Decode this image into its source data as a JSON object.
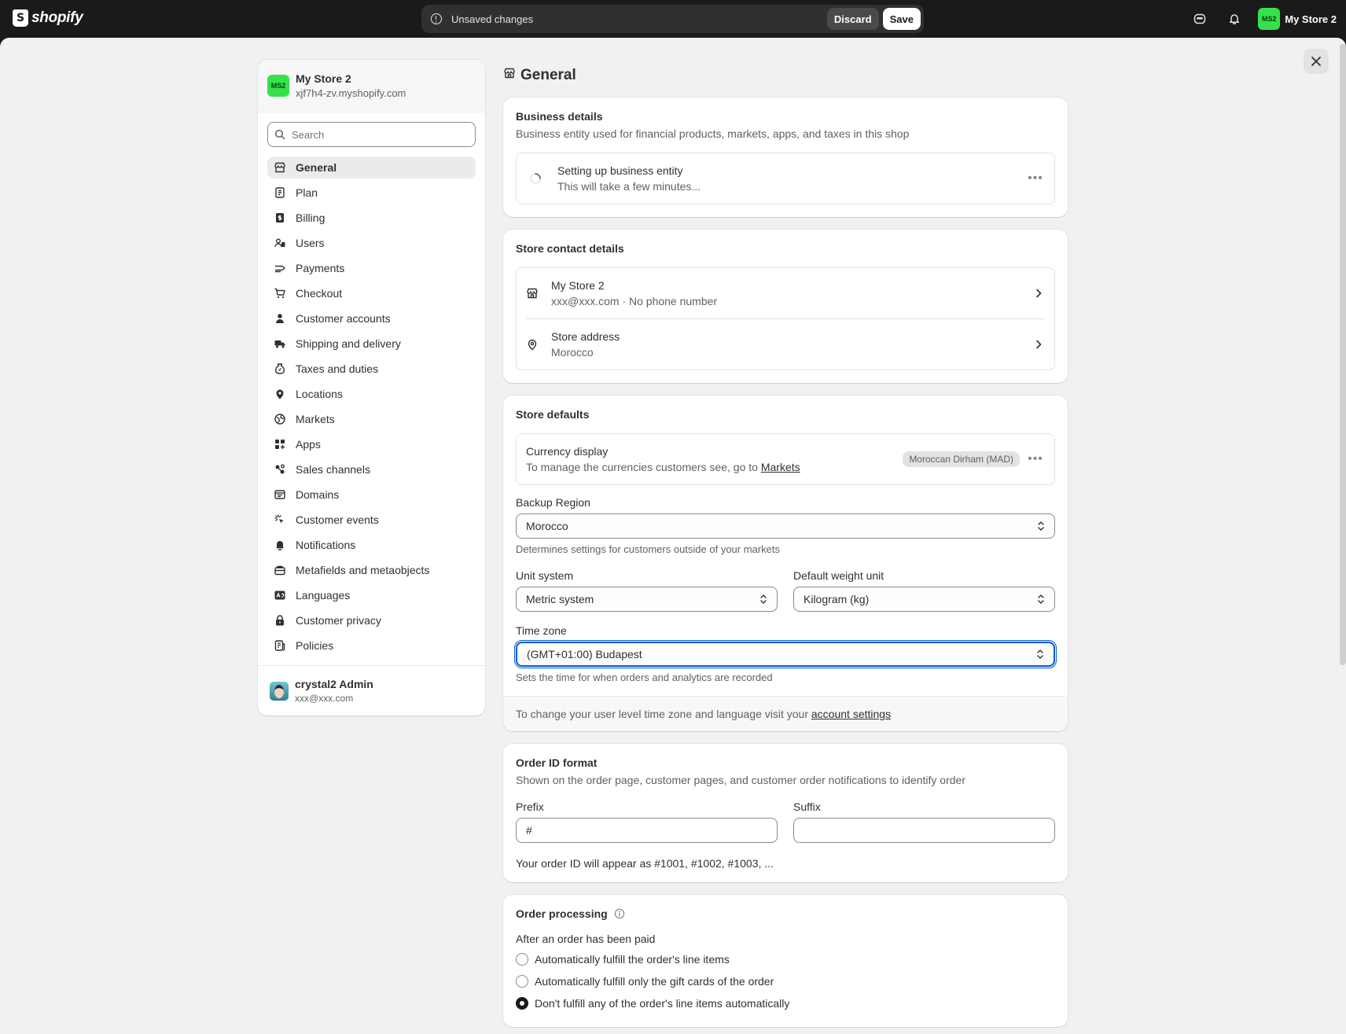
{
  "topbar": {
    "logo_text": "shopify",
    "unsaved_text": "Unsaved changes",
    "discard_label": "Discard",
    "save_label": "Save",
    "avatar_initials": "MS2",
    "store_name": "My Store 2"
  },
  "sidebar": {
    "store_name": "My Store 2",
    "store_domain": "xjf7h4-zv.myshopify.com",
    "avatar_initials": "MS2",
    "search_placeholder": "Search",
    "items": [
      {
        "label": "General",
        "icon": "store-icon"
      },
      {
        "label": "Plan",
        "icon": "plan-icon"
      },
      {
        "label": "Billing",
        "icon": "billing-icon"
      },
      {
        "label": "Users",
        "icon": "users-icon"
      },
      {
        "label": "Payments",
        "icon": "payments-icon"
      },
      {
        "label": "Checkout",
        "icon": "cart-icon"
      },
      {
        "label": "Customer accounts",
        "icon": "person-icon"
      },
      {
        "label": "Shipping and delivery",
        "icon": "truck-icon"
      },
      {
        "label": "Taxes and duties",
        "icon": "tax-icon"
      },
      {
        "label": "Locations",
        "icon": "location-icon"
      },
      {
        "label": "Markets",
        "icon": "globe-icon"
      },
      {
        "label": "Apps",
        "icon": "apps-icon"
      },
      {
        "label": "Sales channels",
        "icon": "channels-icon"
      },
      {
        "label": "Domains",
        "icon": "domains-icon"
      },
      {
        "label": "Customer events",
        "icon": "cursor-icon"
      },
      {
        "label": "Notifications",
        "icon": "bell-icon"
      },
      {
        "label": "Metafields and metaobjects",
        "icon": "metafields-icon"
      },
      {
        "label": "Languages",
        "icon": "language-icon"
      },
      {
        "label": "Customer privacy",
        "icon": "lock-icon"
      },
      {
        "label": "Policies",
        "icon": "policies-icon"
      }
    ],
    "user_name": "crystal2 Admin",
    "user_email": "xxx@xxx.com"
  },
  "main": {
    "page_title": "General",
    "business": {
      "title": "Business details",
      "subtitle": "Business entity used for financial products, markets, apps, and taxes in this shop",
      "status_title": "Setting up business entity",
      "status_sub": "This will take a few minutes..."
    },
    "contact": {
      "title": "Store contact details",
      "store_name": "My Store 2",
      "store_info": "xxx@xxx.com · No phone number",
      "address_title": "Store address",
      "address_value": "Morocco"
    },
    "defaults": {
      "title": "Store defaults",
      "currency_title": "Currency display",
      "currency_sub_prefix": "To manage the currencies customers see, go to ",
      "currency_link": "Markets",
      "currency_badge": "Moroccan Dirham (MAD)",
      "backup_label": "Backup Region",
      "backup_value": "Morocco",
      "backup_help": "Determines settings for customers outside of your markets",
      "unit_label": "Unit system",
      "unit_value": "Metric system",
      "weight_label": "Default weight unit",
      "weight_value": "Kilogram (kg)",
      "tz_label": "Time zone",
      "tz_value": "(GMT+01:00) Budapest",
      "tz_help": "Sets the time for when orders and analytics are recorded",
      "footer_prefix": "To change your user level time zone and language visit your ",
      "footer_link": "account settings"
    },
    "order_id": {
      "title": "Order ID format",
      "subtitle": "Shown on the order page, customer pages, and customer order notifications to identify order",
      "prefix_label": "Prefix",
      "prefix_value": "#",
      "suffix_label": "Suffix",
      "suffix_value": "",
      "preview": "Your order ID will appear as #1001, #1002, #1003, ..."
    },
    "processing": {
      "title": "Order processing",
      "paid_label": "After an order has been paid",
      "options": [
        {
          "label": "Automatically fulfill the order's line items",
          "selected": false
        },
        {
          "label": "Automatically fulfill only the gift cards of the order",
          "selected": false
        },
        {
          "label": "Don't fulfill any of the order's line items automatically",
          "selected": true
        }
      ]
    }
  }
}
